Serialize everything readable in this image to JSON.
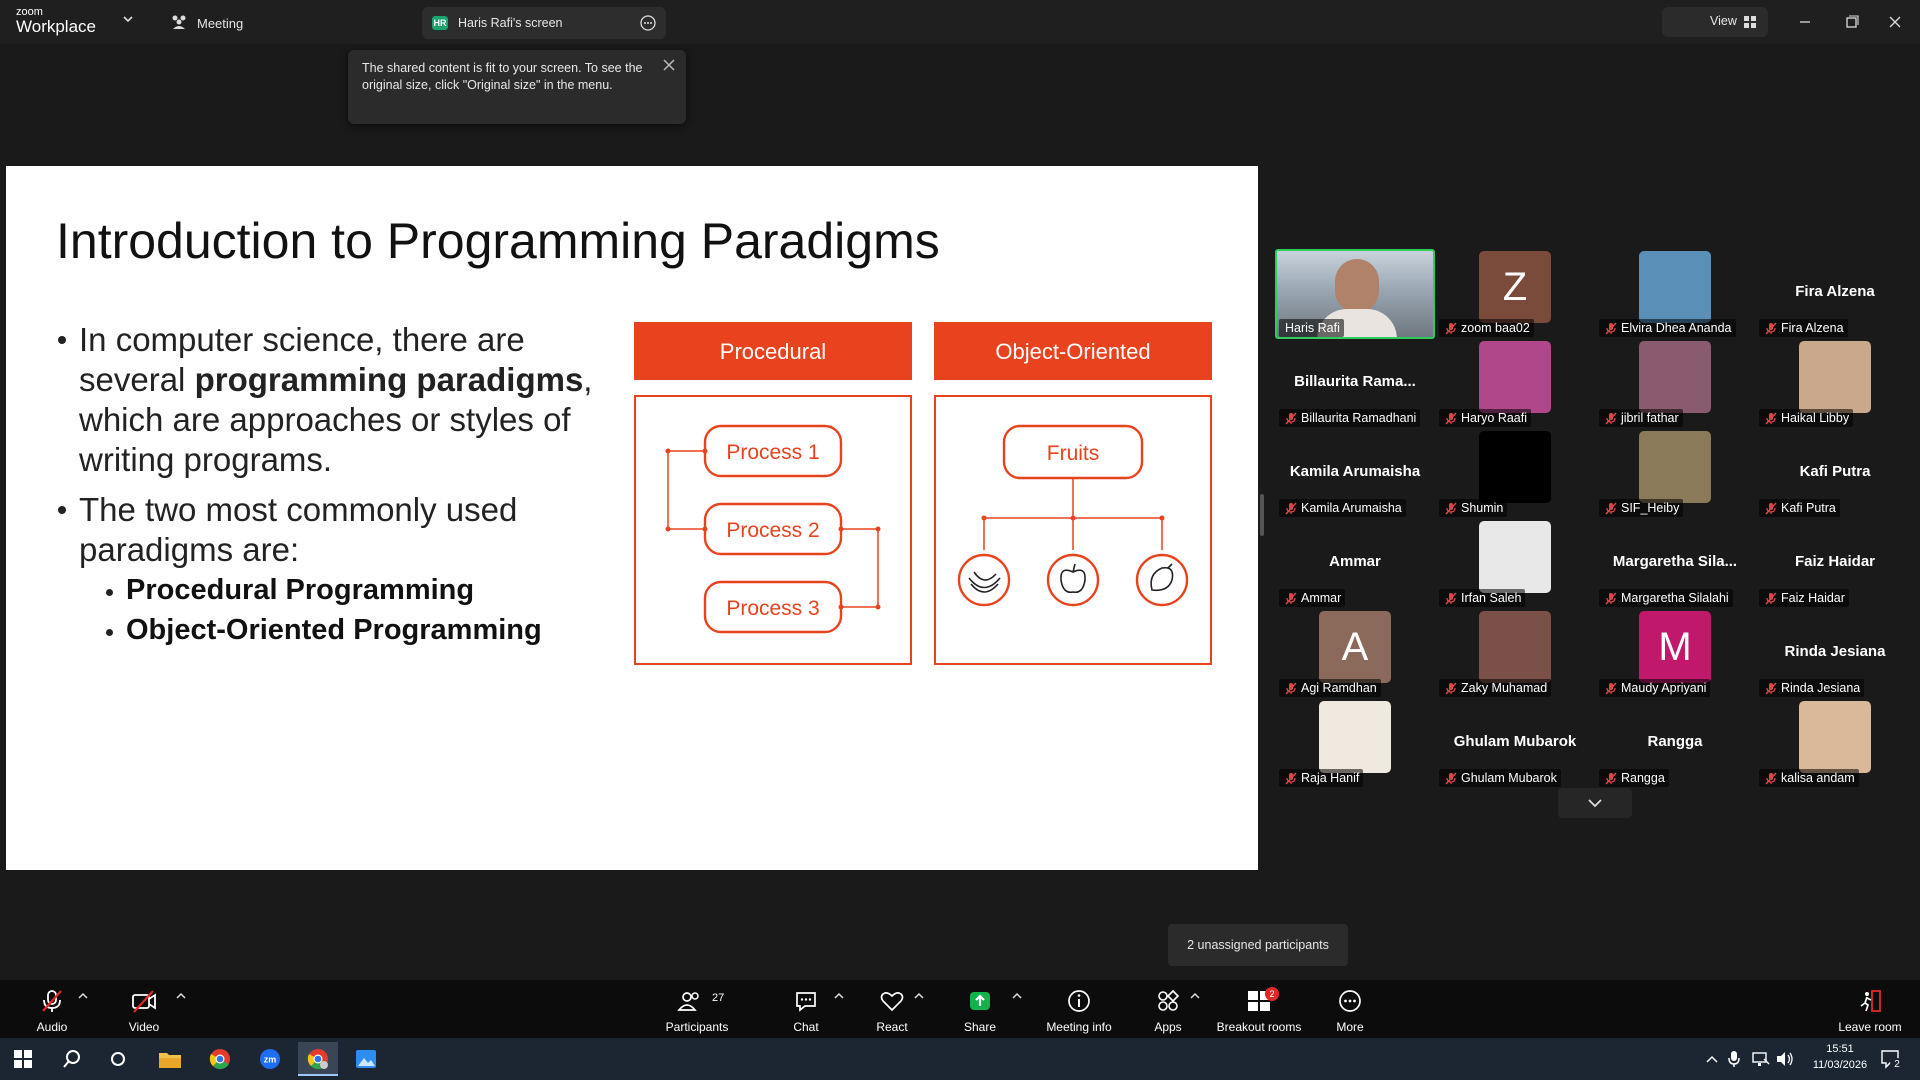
{
  "app": {
    "logo_top": "zoom",
    "logo_bottom": "Workplace",
    "meeting_label": "Meeting",
    "screen_badge": "HR",
    "screen_tab_label": "Haris Rafi's screen",
    "view_label": "View"
  },
  "tooltip": {
    "text": "The shared content is fit to your screen. To see the original size, click \"Original size\" in the menu."
  },
  "slide": {
    "title": "Introduction to Programming Paradigms",
    "bullet1_pre": "In computer science, there are several ",
    "bullet1_bold": "programming paradigms",
    "bullet1_post": ", which are approaches or styles of writing programs.",
    "bullet2": "The two most commonly used paradigms are:",
    "sub1": "Procedural Programming",
    "sub2": "Object-Oriented Programming",
    "diagram": {
      "left_header": "Procedural",
      "right_header": "Object-Oriented",
      "processes": [
        "Process 1",
        "Process 2",
        "Process 3"
      ],
      "root": "Fruits",
      "children_icons": [
        "banana-icon",
        "apple-icon",
        "mango-icon"
      ],
      "accent": "#e8431e"
    }
  },
  "gallery": {
    "tiles": [
      {
        "name": "",
        "label": "Haris Rafi",
        "avatar": "video",
        "active_speaker": true
      },
      {
        "name": "",
        "label": "zoom baa02",
        "avatar": "letter",
        "letter": "Z",
        "color": "#7a4a3a"
      },
      {
        "name": "",
        "label": "Elvira Dhea Ananda",
        "avatar": "photo",
        "color": "#5a8fb8"
      },
      {
        "name": "Fira Alzena",
        "label": "Fira Alzena",
        "avatar": "none"
      },
      {
        "name": "Billaurita  Rama...",
        "label": "Billaurita Ramadhani",
        "avatar": "none"
      },
      {
        "name": "",
        "label": "Haryo Raafi",
        "avatar": "photo",
        "color": "#b0478a"
      },
      {
        "name": "",
        "label": "jibril fathar",
        "avatar": "photo",
        "color": "#8a5b6e"
      },
      {
        "name": "",
        "label": "Haikal Libby",
        "avatar": "photo",
        "color": "#c9a88b"
      },
      {
        "name": "Kamila Arumaisha",
        "label": "Kamila Arumaisha",
        "avatar": "none"
      },
      {
        "name": "",
        "label": "Shumin",
        "avatar": "photo",
        "color": "#000000"
      },
      {
        "name": "",
        "label": "SIF_Heiby",
        "avatar": "photo",
        "color": "#8a7a5a"
      },
      {
        "name": "Kafi Putra",
        "label": "Kafi Putra",
        "avatar": "none"
      },
      {
        "name": "Ammar",
        "label": "Ammar",
        "avatar": "none"
      },
      {
        "name": "",
        "label": "Irfan Saleh",
        "avatar": "photo",
        "color": "#e8e8e8"
      },
      {
        "name": "Margaretha  Sila...",
        "label": "Margaretha Silalahi",
        "avatar": "none"
      },
      {
        "name": "Faiz Haidar",
        "label": "Faiz Haidar",
        "avatar": "none"
      },
      {
        "name": "",
        "label": "Agi Ramdhan",
        "avatar": "letter",
        "letter": "A",
        "color": "#8b6a5c"
      },
      {
        "name": "",
        "label": "Zaky Muhamad",
        "avatar": "photo",
        "color": "#7a5048"
      },
      {
        "name": "",
        "label": "Maudy Apriyani",
        "avatar": "letter",
        "letter": "M",
        "color": "#c0186b"
      },
      {
        "name": "Rinda Jesiana",
        "label": "Rinda Jesiana",
        "avatar": "none"
      },
      {
        "name": "",
        "label": "Raja Hanif",
        "avatar": "photo",
        "color": "#efe9df"
      },
      {
        "name": "Ghulam Mubarok",
        "label": "Ghulam Mubarok",
        "avatar": "none"
      },
      {
        "name": "Rangga",
        "label": "Rangga",
        "avatar": "none"
      },
      {
        "name": "",
        "label": "kalisa andam",
        "avatar": "photo",
        "color": "#d9b99a"
      }
    ]
  },
  "unassigned": "2 unassigned participants",
  "toolbar": {
    "audio": "Audio",
    "video": "Video",
    "participants": "Participants",
    "participants_count": "27",
    "chat": "Chat",
    "react": "React",
    "share": "Share",
    "meeting_info": "Meeting info",
    "apps": "Apps",
    "breakout": "Breakout rooms",
    "breakout_badge": "2",
    "more": "More",
    "leave": "Leave room"
  },
  "taskbar": {
    "time": "15:51",
    "date": "11/03/2026",
    "notif": "2"
  }
}
